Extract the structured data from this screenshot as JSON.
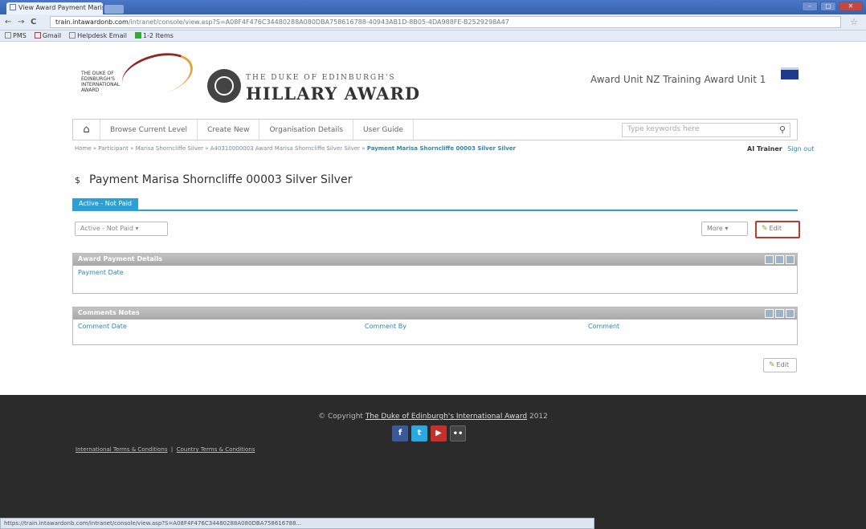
{
  "browser": {
    "tab_title": "View Award Payment Marisa",
    "url_host": "train.intawardonb.com",
    "url_path": "/intranet/console/view.asp?S=A08F4F476C34480288A080DBA758616788-40943AB1D-8B05-4DA988FE-B2529298A47",
    "bookmarks": [
      "PMS",
      "Gmail",
      "Helpdesk Email",
      "1-2 Items"
    ]
  },
  "header": {
    "logo_text": "THE DUKE OF EDINBURGH'S INTERNATIONAL AWARD",
    "brand_top": "THE DUKE OF EDINBURGH'S",
    "brand_main": "HILLARY AWARD",
    "unit_name": "Award Unit NZ Training Award Unit 1"
  },
  "nav": {
    "items": [
      "Browse Current Level",
      "Create New",
      "Organisation Details",
      "User Guide"
    ],
    "search_placeholder": "Type keywords here"
  },
  "breadcrumb": {
    "path": "Home » Participant » Marisa Shorncliffe Silver » A40310000003 Award Marisa Shorncliffe Silver Silver »",
    "current": "Payment Marisa Shorncliffe 00003 Silver Silver"
  },
  "user": {
    "name": "AI Trainer",
    "signout": "Sign out"
  },
  "page": {
    "title": "Payment Marisa Shorncliffe 00003 Silver Silver",
    "active_tab": "Active - Not Paid",
    "status_select": "Active - Not Paid",
    "more_label": "More",
    "edit_label": "Edit"
  },
  "panels": {
    "payment": {
      "title": "Award Payment Details",
      "field": "Payment Date"
    },
    "comments": {
      "title": "Comments Notes",
      "columns": [
        "Comment Date",
        "Comment By",
        "Comment"
      ]
    }
  },
  "footer": {
    "copyright_prefix": "© Copyright",
    "org": "The Duke of Edinburgh's International Award",
    "year": "2012",
    "links": [
      "International Terms & Conditions",
      "Country Terms & Conditions"
    ]
  },
  "statusbar": "https://train.intawardonb.com/intranet/console/view.asp?S=A08F4F476C34480288A080DBA758616788..."
}
